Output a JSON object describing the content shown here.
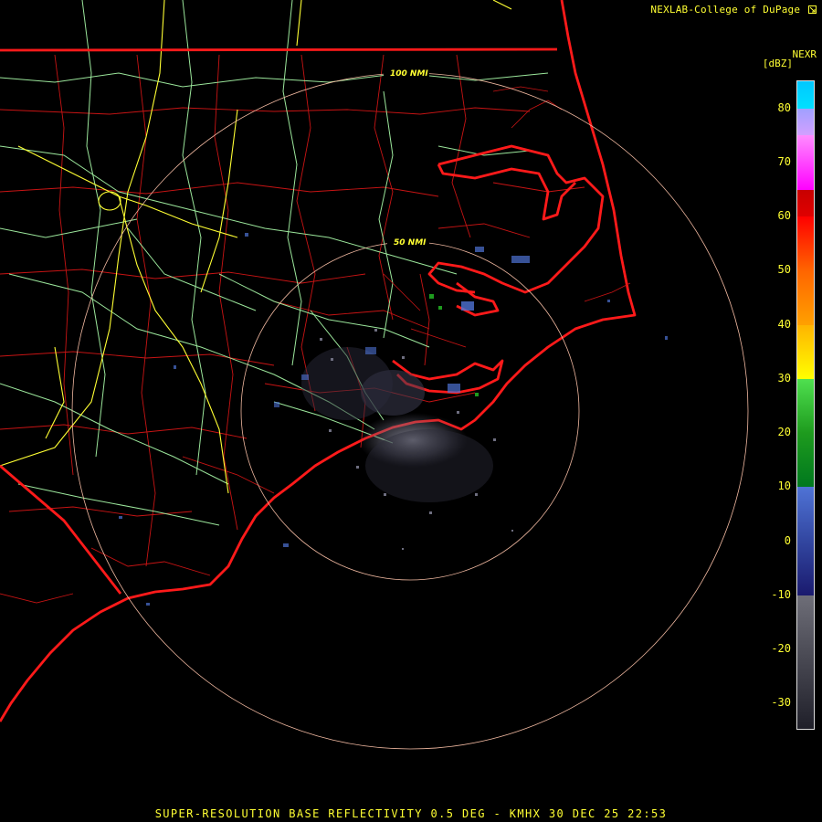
{
  "header": {
    "credit": "NEXLAB-College of DuPage",
    "credit_icon": "corner-arrow-icon",
    "product": "NEXR",
    "units": "[dBZ]"
  },
  "footer": {
    "caption": "SUPER-RESOLUTION BASE REFLECTIVITY 0.5 DEG - KMHX 30 DEC 25 22:53"
  },
  "range_rings": [
    {
      "label": "50 NMI",
      "radius_nmi": 50
    },
    {
      "label": "100 NMI",
      "radius_nmi": 100
    }
  ],
  "colorbar": {
    "min_dbz": -35,
    "max_dbz": 85,
    "ticks": [
      "80",
      "70",
      "60",
      "50",
      "40",
      "30",
      "20",
      "10",
      "0",
      "-10",
      "-20",
      "-30"
    ],
    "segments": [
      {
        "from": -35,
        "to": -10,
        "color": "#1e1e28",
        "color_to": "#6e6e78"
      },
      {
        "from": -10,
        "to": 0,
        "color": "#1a1a6e",
        "color_to": "#3246a0"
      },
      {
        "from": 0,
        "to": 10,
        "color": "#3246a0",
        "color_to": "#4f73d6"
      },
      {
        "from": 10,
        "to": 20,
        "color": "#00781e",
        "color_to": "#1e9b1e"
      },
      {
        "from": 20,
        "to": 30,
        "color": "#1e9b1e",
        "color_to": "#4fe04f"
      },
      {
        "from": 30,
        "to": 40,
        "color": "#ffff00",
        "color_to": "#ffb400"
      },
      {
        "from": 40,
        "to": 50,
        "color": "#ffa000",
        "color_to": "#ff6400"
      },
      {
        "from": 50,
        "to": 60,
        "color": "#ff6400",
        "color_to": "#ff0000"
      },
      {
        "from": 60,
        "to": 65,
        "color": "#e00000",
        "color_to": "#c80000"
      },
      {
        "from": 65,
        "to": 75,
        "color": "#ff00ff",
        "color_to": "#ff8cff"
      },
      {
        "from": 75,
        "to": 80,
        "color": "#d2a0ff",
        "color_to": "#a0a0ff"
      },
      {
        "from": 80,
        "to": 85,
        "color": "#00e0ff",
        "color_to": "#00c8ff"
      }
    ]
  },
  "colors": {
    "state_border": "#ff1a1a",
    "county_border": "#c81414",
    "highway": "#9be69b",
    "interstate": "#ffff33",
    "range_ring": "#f0b8a0",
    "text": "#ffff33"
  }
}
